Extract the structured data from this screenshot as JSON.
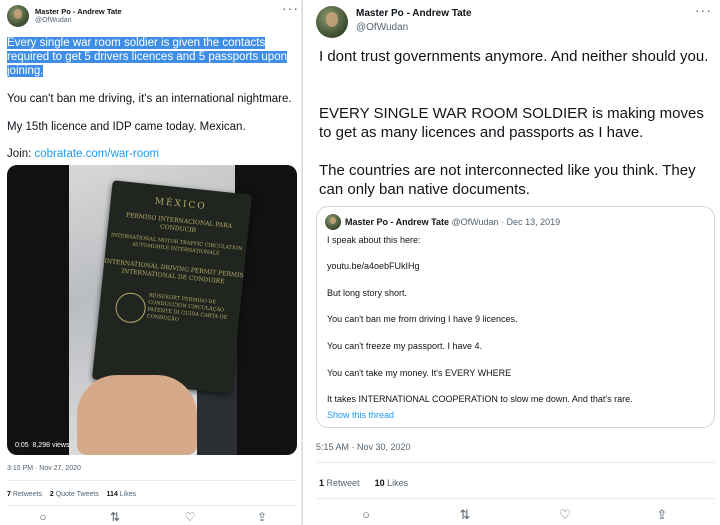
{
  "left_tweet": {
    "author_name": "Master Po - Andrew Tate",
    "author_handle": "@OfWudan",
    "para1": "Every single war room soldier is given the contacts required to get 5 drivers licences and 5 passports upon joining.",
    "para2": "You can't ban me driving, it's an international nightmare.",
    "para3": "My 15th licence and IDP came today. Mexican.",
    "join_label": "Join:",
    "join_link": "cobratate.com/war-room",
    "media": {
      "passport_country": "MÉXICO",
      "passport_title": "PERMISO INTERNACIONAL PARA CONDUCIR",
      "passport_sub": "INTERNATIONAL MOTOR TRAFFIC CIRCULATION AUTOMOBILE INTERNATIONALE",
      "passport_permit": "INTERNATIONAL DRIVING PERMIT PERMIS INTERNATIONAL DE CONDUIRE",
      "passport_langs": "REISEKORT PERMISO DE CONDUCCIÓN CIRCULAÇÃO PATENTE DI GUIDA CARTA DE CONDUÇÃO",
      "duration": "0:05",
      "views": "8,298 views"
    },
    "timestamp": "3:15 PM · Nov 27, 2020",
    "retweets_count": "7",
    "retweets_label": "Retweets",
    "quotes_count": "2",
    "quotes_label": "Quote Tweets",
    "likes_count": "114",
    "likes_label": "Likes"
  },
  "right_tweet": {
    "author_name": "Master Po - Andrew Tate",
    "author_handle": "@OfWudan",
    "para1": "I dont trust governments anymore. And neither should you.",
    "para2": "EVERY SINGLE WAR ROOM SOLDIER is making moves to get as many licences and passports as I have.",
    "para3": "The countries are not interconnected like you think. They can only ban native documents.",
    "quote": {
      "author_name": "Master Po - Andrew Tate",
      "author_handle": "@OfWudan",
      "date": "· Dec 13, 2019",
      "line1": "I speak about this here:",
      "line2": "youtu.be/a4oebFUkIHg",
      "line3": "But long story short.",
      "line4": "You can't ban me from driving I have 9 licences.",
      "line5": "You can't freeze my passport. I have 4.",
      "line6": "You can't take my money. It's EVERY WHERE",
      "line7": "It takes INTERNATIONAL COOPERATION to slow me down. And that's rare.",
      "show_thread": "Show this thread"
    },
    "timestamp": "5:15 AM · Nov 30, 2020",
    "retweets_count": "1",
    "retweets_label": "Retweet",
    "likes_count": "10",
    "likes_label": "Likes"
  },
  "icons": {
    "reply": "○",
    "retweet": "⇅",
    "like": "♡",
    "share": "⇪",
    "more": "···"
  },
  "colors": {
    "link": "#1d9bf0",
    "highlight": "#3f8ee6",
    "muted": "#536471"
  }
}
